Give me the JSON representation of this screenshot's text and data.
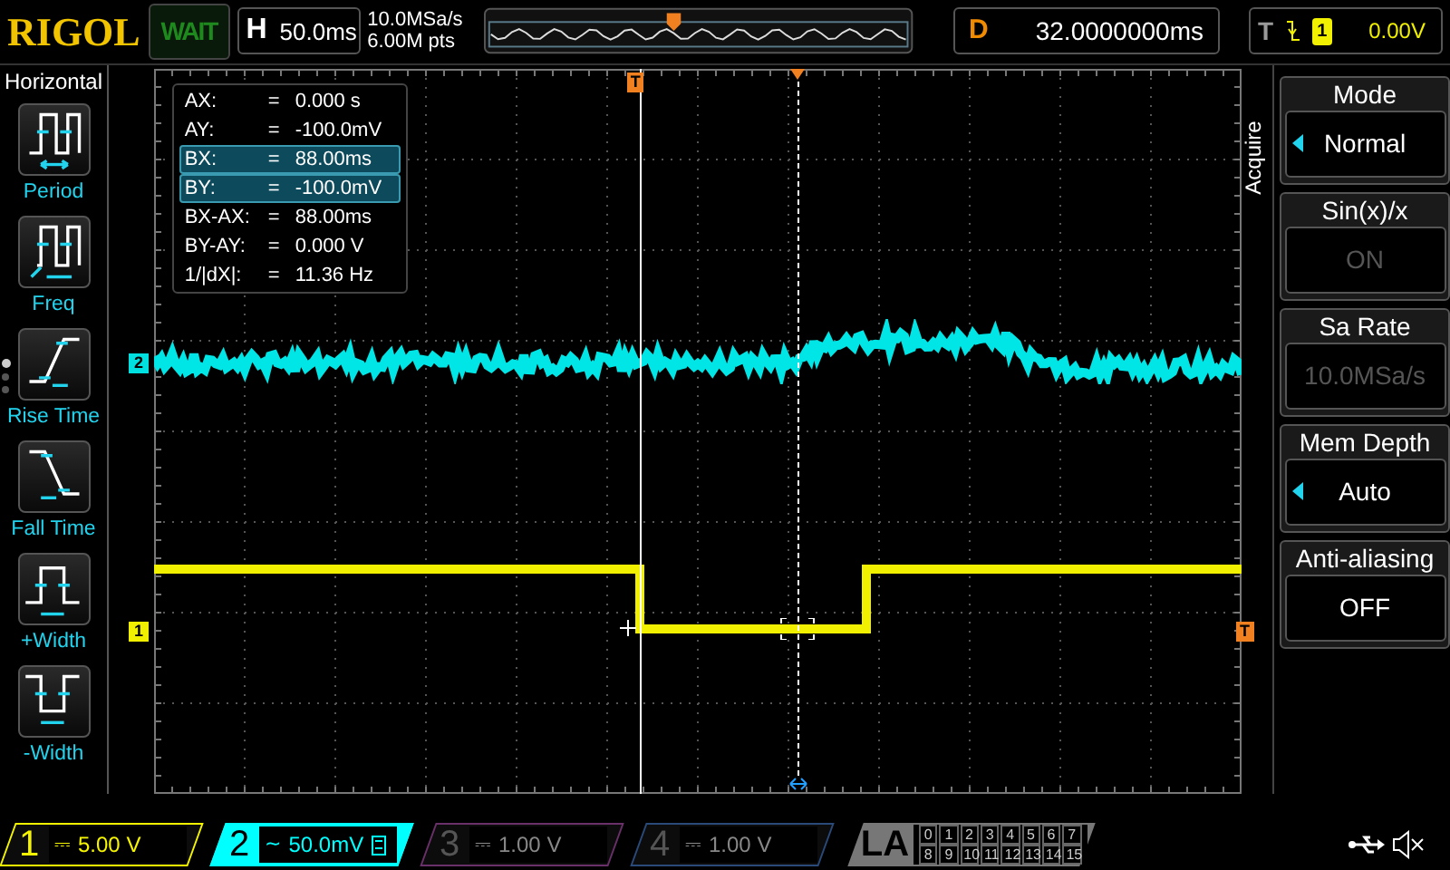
{
  "brand": "RIGOL",
  "run_status": "WAIT",
  "horizontal": {
    "label": "H",
    "value": "50.0ms"
  },
  "sample_rate": "10.0MSa/s",
  "memory": "6.00M pts",
  "delay": {
    "label": "D",
    "value": "32.0000000ms"
  },
  "trigger": {
    "label": "T",
    "source": "1",
    "level": "0.00V"
  },
  "sidebar": {
    "title": "Horizontal",
    "pages": [
      {
        "selected": true
      },
      {
        "selected": false
      },
      {
        "selected": false
      }
    ],
    "items": [
      {
        "label": "Period",
        "kind": "period"
      },
      {
        "label": "Freq",
        "kind": "freq"
      },
      {
        "label": "Rise Time",
        "kind": "rise"
      },
      {
        "label": "Fall Time",
        "kind": "fall"
      },
      {
        "label": "+Width",
        "kind": "pwidth"
      },
      {
        "label": "-Width",
        "kind": "nwidth"
      }
    ]
  },
  "cursor_readout": [
    {
      "name": "AX:",
      "equals": "=",
      "value": "0.000 s",
      "selected": false
    },
    {
      "name": "AY:",
      "equals": "=",
      "value": "-100.0mV",
      "selected": false
    },
    {
      "name": "BX:",
      "equals": "=",
      "value": "88.00ms",
      "selected": true
    },
    {
      "name": "BY:",
      "equals": "=",
      "value": "-100.0mV",
      "selected": true
    },
    {
      "name": "BX-AX:",
      "equals": "=",
      "value": "88.00ms",
      "selected": false
    },
    {
      "name": "BY-AY:",
      "equals": "=",
      "value": "0.000 V",
      "selected": false
    },
    {
      "name": "1/|dX|:",
      "equals": "=",
      "value": "11.36 Hz",
      "selected": false
    }
  ],
  "markers": {
    "channel_2": "2",
    "channel_1": "1",
    "trigger_top": "T",
    "trigger_level": "T"
  },
  "menu": {
    "title": "Acquire",
    "items": [
      {
        "label": "Mode",
        "value": "Normal",
        "disabled": false,
        "has_options": true
      },
      {
        "label": "Sin(x)/x",
        "value": "ON",
        "disabled": true,
        "has_options": false
      },
      {
        "label": "Sa Rate",
        "value": "10.0MSa/s",
        "disabled": true,
        "has_options": false
      },
      {
        "label": "Mem Depth",
        "value": "Auto",
        "disabled": false,
        "has_options": true
      },
      {
        "label": "Anti-aliasing",
        "value": "OFF",
        "disabled": false,
        "has_options": false
      }
    ]
  },
  "channels": [
    {
      "number": "1",
      "scale": "5.00 V",
      "coupling": "⎓",
      "on": true,
      "selected": false,
      "bw_limit": false,
      "color": "#f5f500"
    },
    {
      "number": "2",
      "scale": "50.0mV",
      "coupling": "~",
      "on": true,
      "selected": true,
      "bw_limit": true,
      "color": "#00ffff"
    },
    {
      "number": "3",
      "scale": "1.00 V",
      "coupling": "⎓",
      "on": false,
      "selected": false,
      "bw_limit": false,
      "color": "#6a306a"
    },
    {
      "number": "4",
      "scale": "1.00 V",
      "coupling": "⎓",
      "on": false,
      "selected": false,
      "bw_limit": false,
      "color": "#2a4a7a"
    }
  ],
  "la": {
    "label": "LA",
    "bits": [
      "0",
      "1",
      "2",
      "3",
      "4",
      "5",
      "6",
      "7",
      "8",
      "9",
      "10",
      "11",
      "12",
      "13",
      "14",
      "15"
    ]
  }
}
